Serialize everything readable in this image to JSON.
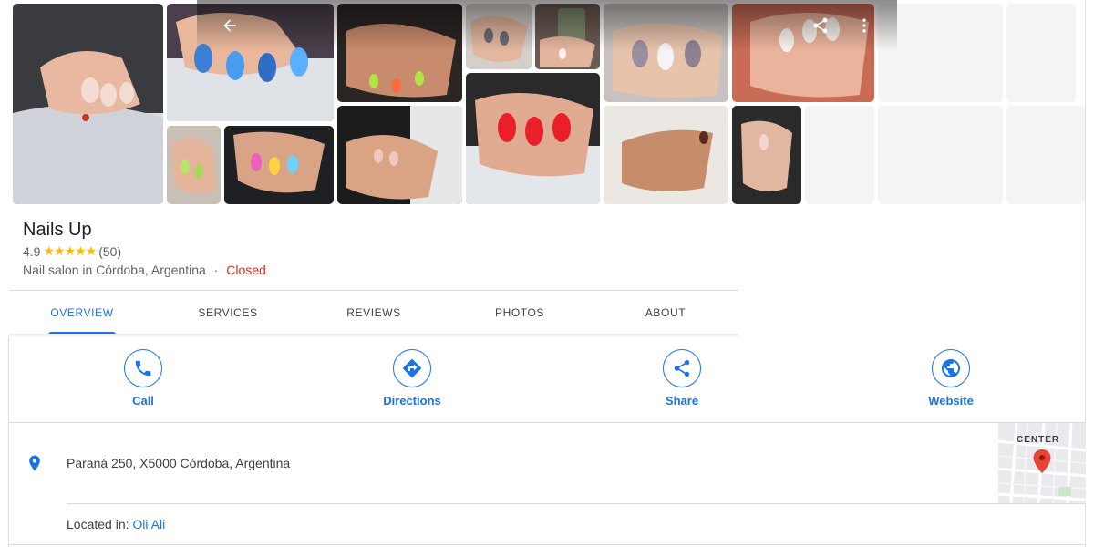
{
  "place": {
    "name": "Nails Up",
    "rating": "4.9",
    "stars": "★★★★★",
    "review_count": "(50)",
    "category": "Nail salon in Córdoba, Argentina",
    "separator": "·",
    "status": "Closed"
  },
  "colors": {
    "accent": "#1a73e8",
    "star": "#fbbc04",
    "closed": "#d93025",
    "text_secondary": "#5f6368"
  },
  "gallery": {
    "photos": [
      {
        "name": "photo-nails-white-cushion"
      },
      {
        "name": "photo-nails-blue-art"
      },
      {
        "name": "photo-nails-green-tips"
      },
      {
        "name": "photo-nails-grey-gloss"
      },
      {
        "name": "photo-nails-phone-hand"
      },
      {
        "name": "photo-nails-lilac-white"
      },
      {
        "name": "photo-nails-speckled"
      },
      {
        "name": "photo-nails-small-green"
      },
      {
        "name": "photo-nails-neon-black"
      },
      {
        "name": "photo-nails-clasped-hands"
      },
      {
        "name": "photo-nails-red-hearts"
      },
      {
        "name": "photo-nails-brown-tips"
      },
      {
        "name": "photo-nails-pink-nude"
      }
    ],
    "icons": {
      "back": "arrow-left-icon",
      "share": "share-icon",
      "more": "more-vert-icon"
    }
  },
  "tabs": [
    {
      "label": "OVERVIEW",
      "active": true
    },
    {
      "label": "SERVICES",
      "active": false
    },
    {
      "label": "REVIEWS",
      "active": false
    },
    {
      "label": "PHOTOS",
      "active": false
    },
    {
      "label": "ABOUT",
      "active": false
    }
  ],
  "actions": [
    {
      "label": "Call",
      "icon": "phone-icon"
    },
    {
      "label": "Directions",
      "icon": "directions-icon"
    },
    {
      "label": "Share",
      "icon": "share-icon"
    },
    {
      "label": "Website",
      "icon": "globe-icon"
    }
  ],
  "address": {
    "icon": "location-pin-icon",
    "text": "Paraná 250, X5000 Córdoba, Argentina"
  },
  "located_in": {
    "prefix": "Located in: ",
    "link": "Oli Ali"
  },
  "map": {
    "label": "CENTER"
  }
}
